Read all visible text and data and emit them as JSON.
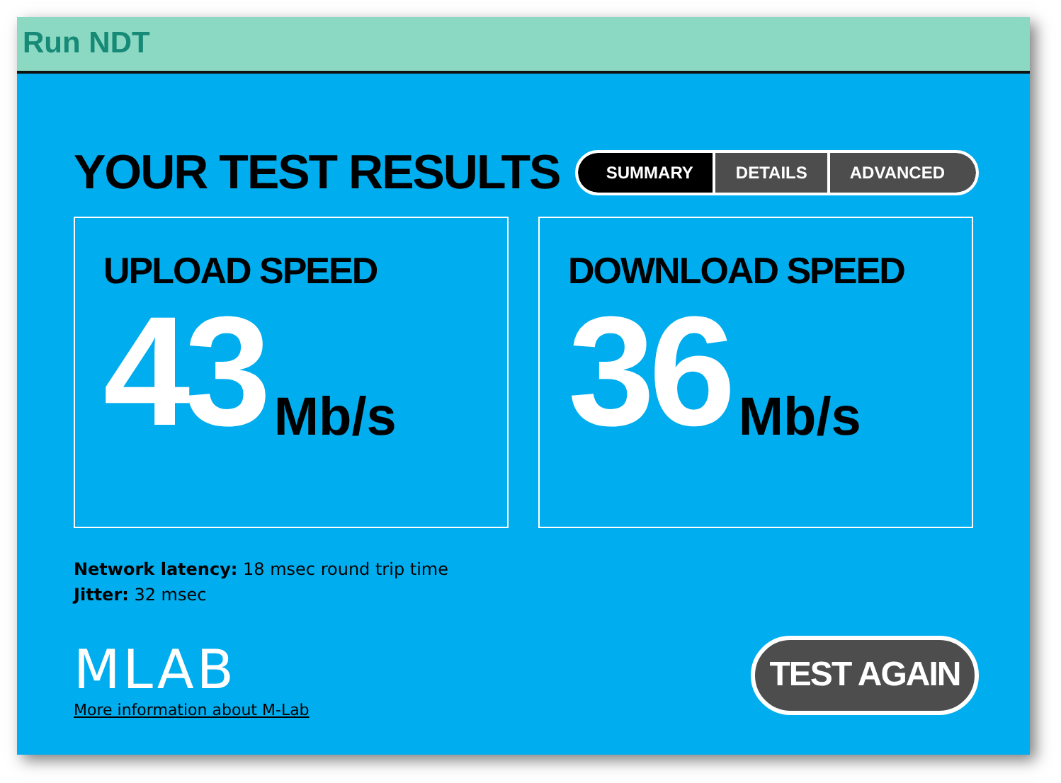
{
  "window": {
    "title": "Run NDT"
  },
  "heading": "YOUR TEST RESULTS",
  "tabs": [
    {
      "label": "SUMMARY",
      "selected": true
    },
    {
      "label": "DETAILS",
      "selected": false
    },
    {
      "label": "ADVANCED",
      "selected": false
    }
  ],
  "results": [
    {
      "label": "UPLOAD SPEED",
      "value": "43",
      "unit": "Mb/s"
    },
    {
      "label": "DOWNLOAD SPEED",
      "value": "36",
      "unit": "Mb/s"
    }
  ],
  "stats": [
    "**Network latency:** 18 msec round trip time",
    "**Jitter:** 32 msec"
  ],
  "logo": "MLAB",
  "link": "More information about M-Lab",
  "button": "TEST AGAIN"
}
